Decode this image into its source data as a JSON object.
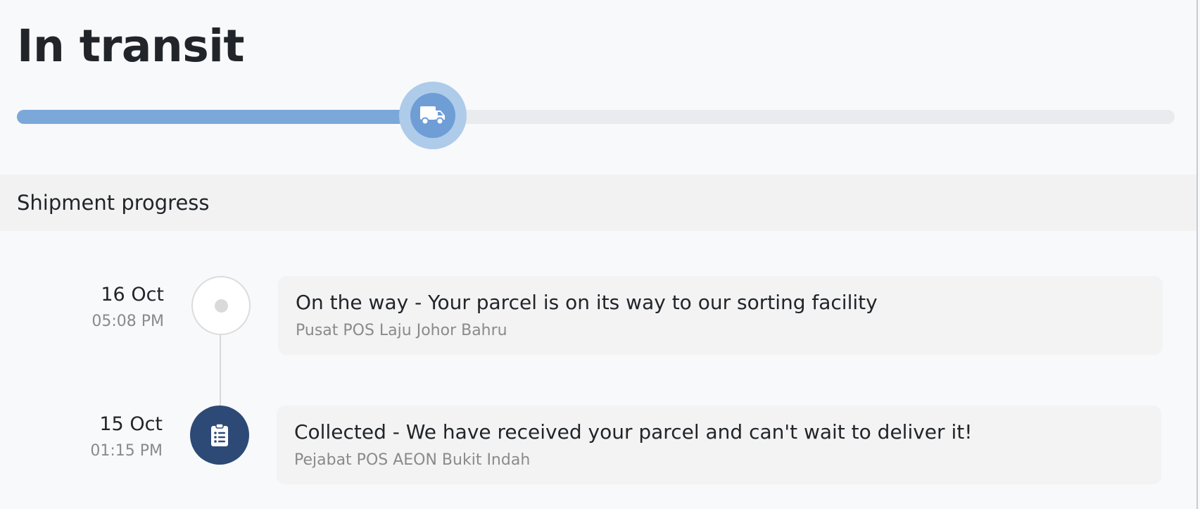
{
  "status": {
    "title": "In transit",
    "progress_fraction": 0.36,
    "marker_icon": "truck-icon",
    "fill_color": "#7ba7d9",
    "marker_color": "#6f9dd6"
  },
  "section": {
    "title": "Shipment progress"
  },
  "events": [
    {
      "date": "16 Oct",
      "time": "05:08 PM",
      "description": "On the way - Your parcel is on its way to our sorting facility",
      "location": "Pusat POS Laju Johor Bahru",
      "state": "pending",
      "icon": "dot-icon"
    },
    {
      "date": "15 Oct",
      "time": "01:15 PM",
      "description": "Collected - We have received your parcel and can't wait to deliver it!",
      "location": "Pejabat POS AEON Bukit Indah",
      "state": "done",
      "icon": "clipboard-list-icon",
      "color": "#2d4a76"
    }
  ]
}
